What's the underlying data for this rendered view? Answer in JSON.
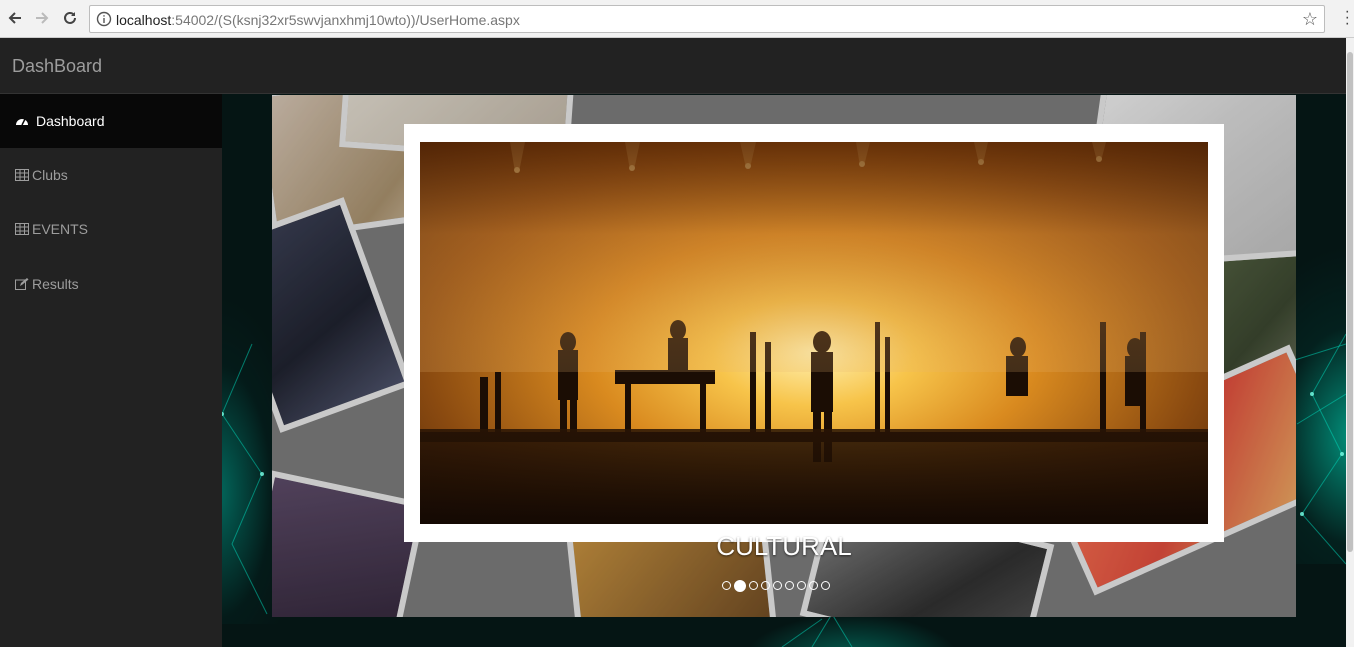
{
  "browser": {
    "url_host": "localhost",
    "url_rest": ":54002/(S(ksnj32xr5swvjanxhmj10wto))/UserHome.aspx"
  },
  "app": {
    "brand": "DashBoard"
  },
  "sidebar": {
    "items": [
      {
        "label": "Dashboard",
        "icon": "dashboard-gauge-icon",
        "active": true
      },
      {
        "label": "Clubs",
        "icon": "table-grid-icon"
      },
      {
        "label": "EVENTS",
        "icon": "table-grid-icon"
      },
      {
        "label": "Results",
        "icon": "edit-icon"
      }
    ]
  },
  "slider": {
    "caption": "CULTURAL",
    "slide_count": 9,
    "active_index": 1
  },
  "colors": {
    "topbar": "#222222",
    "sidebar": "#222222",
    "active_item": "#080808",
    "accent_glow": "#00c8aa"
  }
}
